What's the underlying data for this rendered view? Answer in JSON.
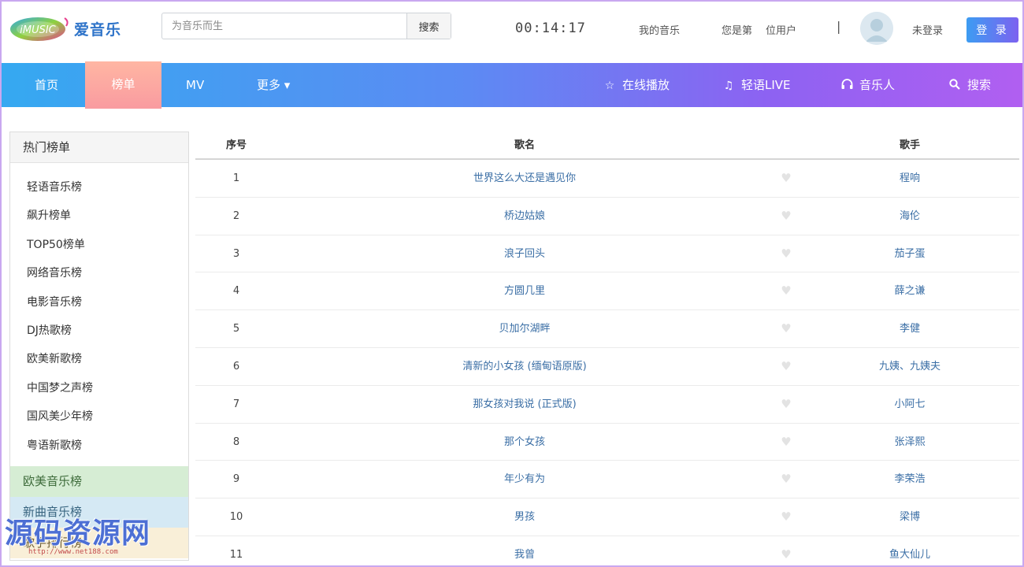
{
  "header": {
    "logo_badge": "iMUSIC",
    "logo_text": "爱音乐",
    "search_placeholder": "为音乐而生",
    "search_button": "搜索",
    "clock": "00:14:17",
    "my_music": "我的音乐",
    "user_count_prefix": "您是第",
    "user_count_suffix": "位用户",
    "separator": "|",
    "login_status": "未登录",
    "login_button": "登 录"
  },
  "nav": {
    "home": "首页",
    "charts": "榜单",
    "mv": "MV",
    "more": "更多 ▾",
    "online_play": "在线播放",
    "live": "轻语LIVE",
    "musicians": "音乐人",
    "search": "搜索"
  },
  "sidebar": {
    "title": "热门榜单",
    "items": [
      "轻语音乐榜",
      "飙升榜单",
      "TOP50榜单",
      "网络音乐榜",
      "电影音乐榜",
      "DJ热歌榜",
      "欧美新歌榜",
      "中国梦之声榜",
      "国风美少年榜",
      "粤语新歌榜"
    ],
    "block_green": "欧美音乐榜",
    "block_blue": "新曲音乐榜",
    "block_yellow": "歌手排行榜"
  },
  "table": {
    "headers": {
      "num": "序号",
      "song": "歌名",
      "artist": "歌手"
    },
    "rows": [
      {
        "num": "1",
        "song": "世界这么大还是遇见你",
        "artist": "程响"
      },
      {
        "num": "2",
        "song": "桥边姑娘",
        "artist": "海伦"
      },
      {
        "num": "3",
        "song": "浪子回头",
        "artist": "茄子蛋"
      },
      {
        "num": "4",
        "song": "方圆几里",
        "artist": "薛之谦"
      },
      {
        "num": "5",
        "song": "贝加尔湖畔",
        "artist": "李健"
      },
      {
        "num": "6",
        "song": "清新的小女孩 (缅甸语原版)",
        "artist": "九姨、九姨夫"
      },
      {
        "num": "7",
        "song": "那女孩对我说 (正式版)",
        "artist": "小阿七"
      },
      {
        "num": "8",
        "song": "那个女孩",
        "artist": "张泽熙"
      },
      {
        "num": "9",
        "song": "年少有为",
        "artist": "李荣浩"
      },
      {
        "num": "10",
        "song": "男孩",
        "artist": "梁博"
      },
      {
        "num": "11",
        "song": "我曾",
        "artist": "鱼大仙儿"
      }
    ]
  },
  "watermark": {
    "title": "源码资源网",
    "url": "http://www.net188.com"
  },
  "colors": {
    "accent_blue": "#3a6ea5",
    "nav_start": "#35a9f1",
    "nav_end": "#b15ff1",
    "active_tab": "#f99ba0"
  },
  "icons": {
    "online_play": "star-icon",
    "live": "music-note-icon",
    "musicians": "headphones-icon",
    "search": "search-icon",
    "favorite": "heart-icon"
  }
}
